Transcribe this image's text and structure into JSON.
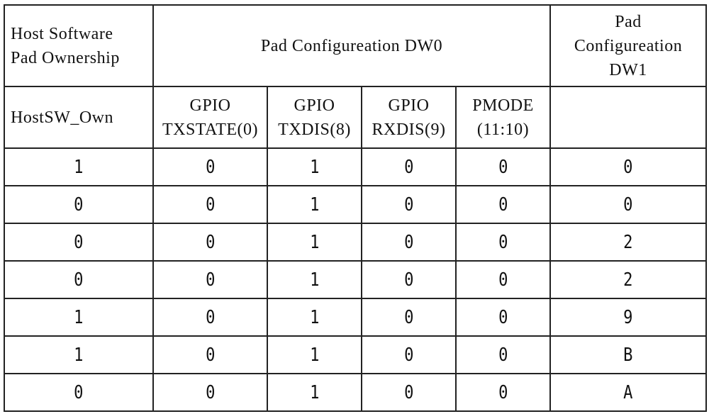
{
  "table": {
    "header_top": {
      "ownership": "Host Software Pad Ownership",
      "ownership_lines": [
        "Host Software",
        "Pad Ownership"
      ],
      "dw0": "Pad Configureation DW0",
      "dw1_lines": [
        "Pad",
        "Configureation",
        "DW1"
      ]
    },
    "header_sub": {
      "hostsw": "HostSW_Own",
      "txstate": [
        "GPIO",
        "TXSTATE(0)"
      ],
      "txdis": [
        "GPIO",
        "TXDIS(8)"
      ],
      "rxdis": [
        "GPIO",
        "RXDIS(9)"
      ],
      "pmode": [
        "PMODE",
        "(11:10)"
      ],
      "dw1": ""
    },
    "rows": [
      [
        "1",
        "0",
        "1",
        "0",
        "0",
        "0"
      ],
      [
        "0",
        "0",
        "1",
        "0",
        "0",
        "0"
      ],
      [
        "0",
        "0",
        "1",
        "0",
        "0",
        "2"
      ],
      [
        "0",
        "0",
        "1",
        "0",
        "0",
        "2"
      ],
      [
        "1",
        "0",
        "1",
        "0",
        "0",
        "9"
      ],
      [
        "1",
        "0",
        "1",
        "0",
        "0",
        "B"
      ],
      [
        "0",
        "0",
        "1",
        "0",
        "0",
        "A"
      ]
    ]
  }
}
